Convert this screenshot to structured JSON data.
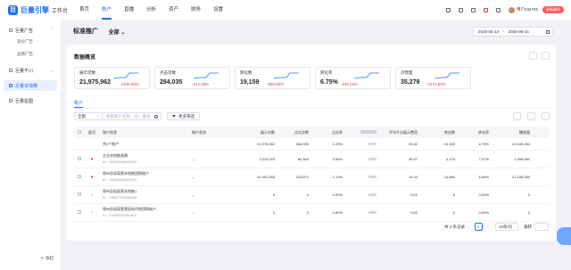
{
  "topbar": {
    "logo_mark": "巨",
    "logo_text": "巨量引擎",
    "logo_sub": "工作台",
    "nav": [
      "首页",
      "账户",
      "直播",
      "分析",
      "资产",
      "财务",
      "设置"
    ],
    "active_nav": "账户",
    "user_name": "用户234702",
    "badge": "更新福利"
  },
  "sidebar": {
    "groups": [
      {
        "label": "巨量广告",
        "subs": [
          "竞价广告",
          "品牌广告"
        ]
      },
      {
        "label": "巨量千川",
        "subs": []
      },
      {
        "label": "巨量本地推",
        "subs": [],
        "active": true
      },
      {
        "label": "巨量星图",
        "subs": []
      }
    ],
    "collapse_label": "收起"
  },
  "header": {
    "title": "标准推广",
    "scope": "全部",
    "date_start": "2025-05-13",
    "date_end": "2025-06-15"
  },
  "overview": {
    "title": "数据概览",
    "metrics": [
      {
        "label": "展示次数",
        "value": "21,975,962",
        "change": "-1200.08%"
      },
      {
        "label": "点击次数",
        "value": "284,035",
        "change": "-212.28%"
      },
      {
        "label": "转化数",
        "value": "19,159",
        "change": "-980.60%"
      },
      {
        "label": "转化率",
        "value": "6.75%",
        "change": "-246.15%"
      },
      {
        "label": "点赞量",
        "value": "35,279",
        "change": "-2174.60%"
      }
    ]
  },
  "tabs": {
    "account": "账户"
  },
  "filters": {
    "scope": "全部",
    "search_placeholder": "搜索账户名称、ID、备注",
    "more": "更多筛选"
  },
  "table": {
    "headers": {
      "fav": "星活",
      "name": "账户信息",
      "status": "账户状态",
      "impressions": "展示次数",
      "clicks": "点击次数",
      "ctr": "点击率",
      "avg": "平均千次展示费用",
      "conversions": "转化数",
      "cvr": "转化率",
      "likes": "播放量"
    },
    "total": {
      "name": "共4个账户",
      "impressions": "21,975,962",
      "clicks": "284,035",
      "ctr": "1.29%",
      "avg": "29.82",
      "conversions": "19,159",
      "cvr": "6.75%",
      "likes": "22,640,254"
    },
    "rows": [
      {
        "name": "企业本地推直播",
        "id": "ID：1823005966292995",
        "status": "--",
        "fav": true,
        "impressions": "1,574,029",
        "clicks": "60,464",
        "ctr": "3.84%",
        "avg": "35.57",
        "conversions": "4,275",
        "cvr": "7.07%",
        "likes": "1,398,994"
      },
      {
        "name": "郑州总现离营本地推团购账户",
        "id": "ID：1826306429901210",
        "status": "--",
        "fav": true,
        "impressions": "20,401,933",
        "clicks": "223,571",
        "ctr": "1.10%",
        "avg": "19.44",
        "conversions": "14,884",
        "cvr": "6.66%",
        "likes": "21,246,390"
      },
      {
        "name": "郑州总现离营本地推1",
        "id": "ID：1786277643398696",
        "status": "--",
        "fav": false,
        "impressions": "0",
        "clicks": "0",
        "ctr": "0.00%",
        "avg": "0.00",
        "conversions": "0",
        "cvr": "0.00%",
        "likes": "0"
      },
      {
        "name": "郑州总现离营营现现代地团购账户",
        "id": "ID：1796851511861812",
        "status": "--",
        "fav": false,
        "impressions": "0",
        "clicks": "0",
        "ctr": "0.00%",
        "avg": "0.00",
        "conversions": "0",
        "cvr": "0.00%",
        "likes": "0"
      }
    ]
  },
  "pager": {
    "total": "共 4 条记录",
    "current": "1",
    "page_size": "10条/页",
    "jump": "跳转"
  }
}
